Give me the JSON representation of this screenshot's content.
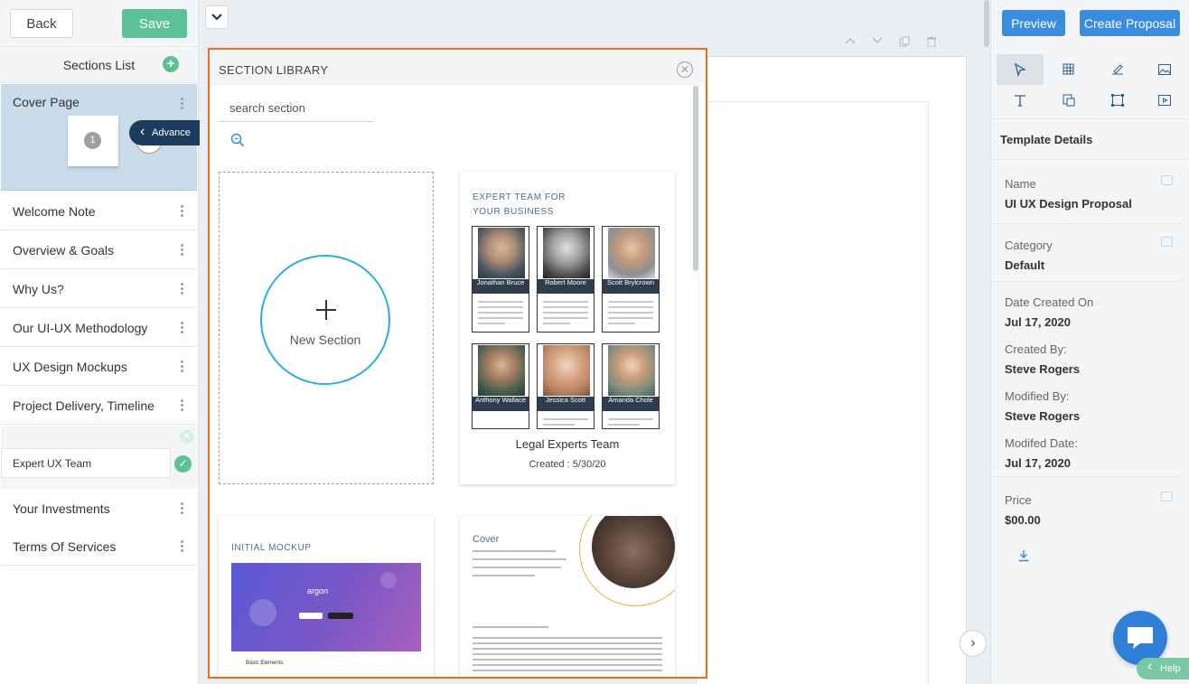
{
  "toolbar": {
    "back_label": "Back",
    "save_label": "Save"
  },
  "sections": {
    "header": "Sections List",
    "cover": {
      "label": "Cover Page",
      "page_number": "1"
    },
    "items": [
      "Welcome Note",
      "Overview & Goals",
      "Why Us?",
      "Our UI-UX Methodology",
      "UX Design Mockups",
      "Project Delivery, Timeline"
    ],
    "editing_value": "Expert UX Team",
    "items_after": [
      "Your Investments",
      "Terms Of Services"
    ]
  },
  "library": {
    "title": "SECTION LIBRARY",
    "search_placeholder": "search section",
    "new_section_label": "New Section",
    "cards": [
      {
        "heading_line1": "EXPERT TEAM FOR",
        "heading_line2": "YOUR BUSINESS",
        "people": [
          "Jonathan Bruce",
          "Robert Moore",
          "Scott Brylcrown",
          "Anthony Wallace",
          "Jessica Scott",
          "Amanda Chole"
        ],
        "name": "Legal Experts Team",
        "created": "Created : 5/30/20"
      },
      {
        "heading": "INITIAL MOCKUP",
        "logo": "argon",
        "footer": "Basic Elements"
      },
      {
        "heading": "Cover"
      }
    ]
  },
  "right": {
    "preview_label": "Preview",
    "create_label": "Create Proposal",
    "template_details_label": "Template Details",
    "advance_label": "Advance",
    "fields": [
      {
        "key": "Name",
        "value": "UI UX Design Proposal"
      },
      {
        "key": "Category",
        "value": "Default"
      },
      {
        "key": "Date Created On",
        "value": "Jul 17, 2020"
      },
      {
        "key": "Created By:",
        "value": "Steve Rogers"
      },
      {
        "key": "Modified By:",
        "value": "Steve Rogers"
      },
      {
        "key": "Modifed Date:",
        "value": "Jul 17, 2020"
      },
      {
        "key": "Price",
        "value": "$00.00"
      }
    ],
    "help_label": "Help"
  },
  "colors": {
    "accent_green": "#5cc197",
    "accent_blue": "#3a8dde",
    "highlight_orange": "#f26b1d",
    "navy": "#1c3c5e"
  }
}
